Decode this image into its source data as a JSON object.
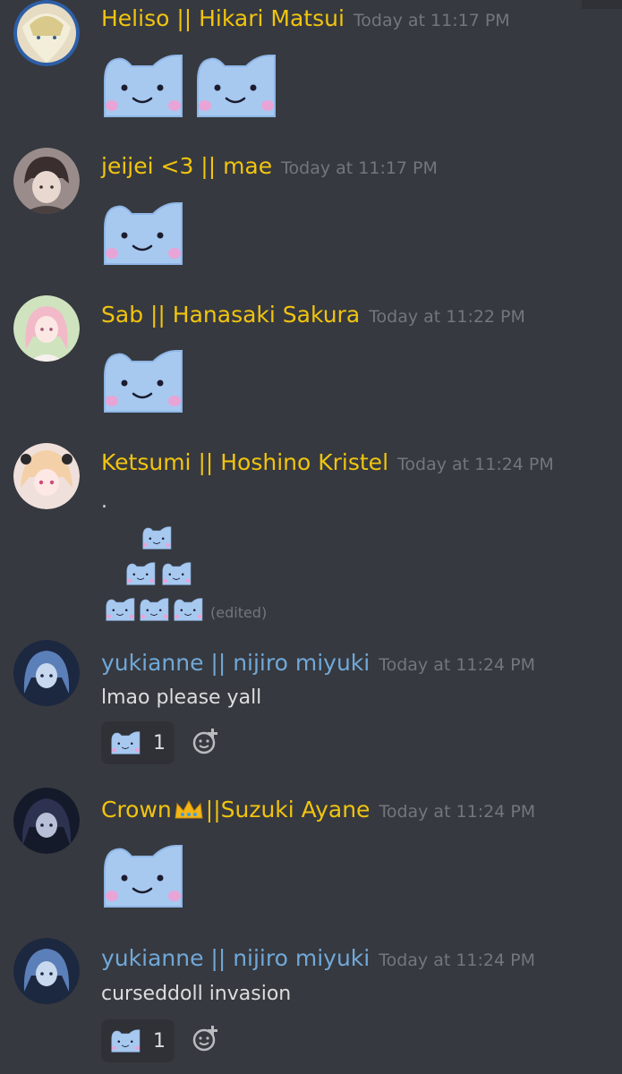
{
  "messages": [
    {
      "username": "Heliso || Hikari Matsui",
      "timestamp": "Today at 11:17 PM",
      "color": "#f1c40f",
      "emoji_count": 2
    },
    {
      "username": "jeijei <3 || mae",
      "timestamp": "Today at 11:17 PM",
      "color": "#f1c40f",
      "emoji_count": 1
    },
    {
      "username": "Sab || Hanasaki Sakura",
      "timestamp": "Today at 11:22 PM",
      "color": "#f1c40f",
      "emoji_count": 1
    },
    {
      "username": "Ketsumi || Hoshino Kristel",
      "timestamp": "Today at 11:24 PM",
      "color": "#f1c40f",
      "text": ".",
      "edited": "(edited)"
    },
    {
      "username": "yukianne || nijiro miyuki",
      "timestamp": "Today at 11:24 PM",
      "color": "#71a8d8",
      "text": "lmao please yall",
      "reaction_count": "1"
    },
    {
      "username_prefix": "Crown",
      "username_suffix": "||Suzuki Ayane",
      "timestamp": "Today at 11:24 PM",
      "color": "#f1c40f",
      "emoji_count": 1,
      "crown_icon": "crown-icon"
    },
    {
      "username": "yukianne || nijiro miyuki",
      "timestamp": "Today at 11:24 PM",
      "color": "#71a8d8",
      "text": "curseddoll invasion",
      "reaction_count": "1"
    }
  ],
  "emoji_name": "curseddoll",
  "colors": {
    "background": "#36393f",
    "gold_name": "#f1c40f",
    "blue_name": "#71a8d8",
    "timestamp": "#72767d",
    "reaction_bg": "#2f3136"
  }
}
